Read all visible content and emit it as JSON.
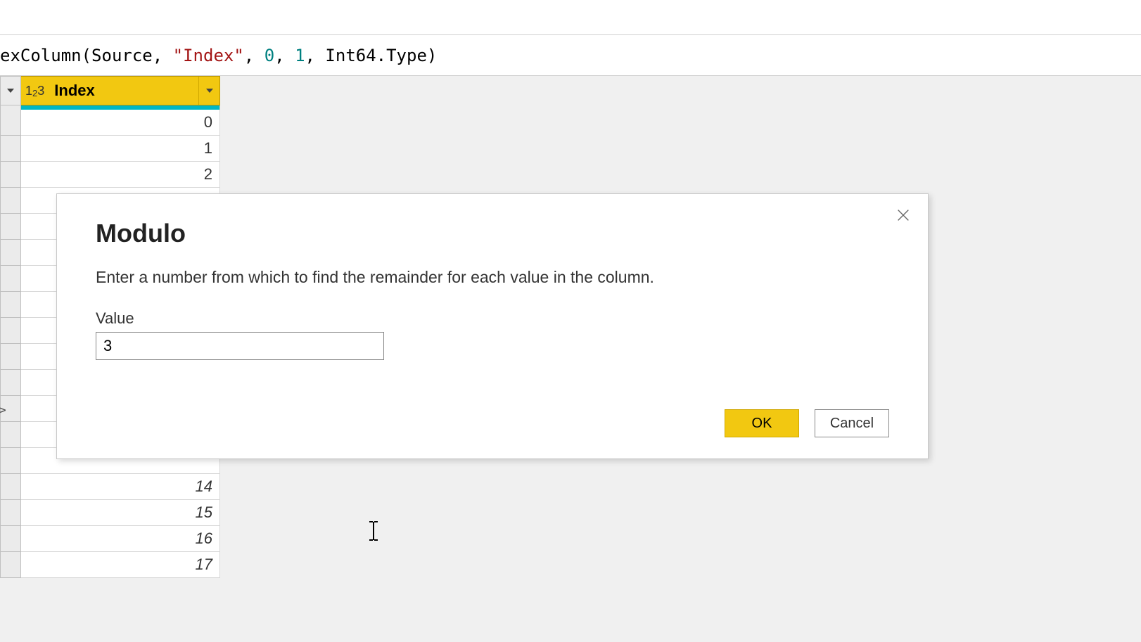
{
  "formula": {
    "prefix": "exColumn(Source, ",
    "string_arg": "\"Index\"",
    "comma1": ", ",
    "num1": "0",
    "comma2": ", ",
    "num2": "1",
    "comma3": ", Int64.Type)",
    "type_prefix": "1",
    "type_sub": "2",
    "type_suffix": "3"
  },
  "column": {
    "name": "Index"
  },
  "rows_top": [
    "0",
    "1",
    "2"
  ],
  "rows_bottom": [
    "14",
    "15",
    "16",
    "17"
  ],
  "expand_marker": ">",
  "dialog": {
    "title": "Modulo",
    "description": "Enter a number from which to find the remainder for each value in the column.",
    "value_label": "Value",
    "value": "3",
    "ok_label": "OK",
    "cancel_label": "Cancel"
  }
}
